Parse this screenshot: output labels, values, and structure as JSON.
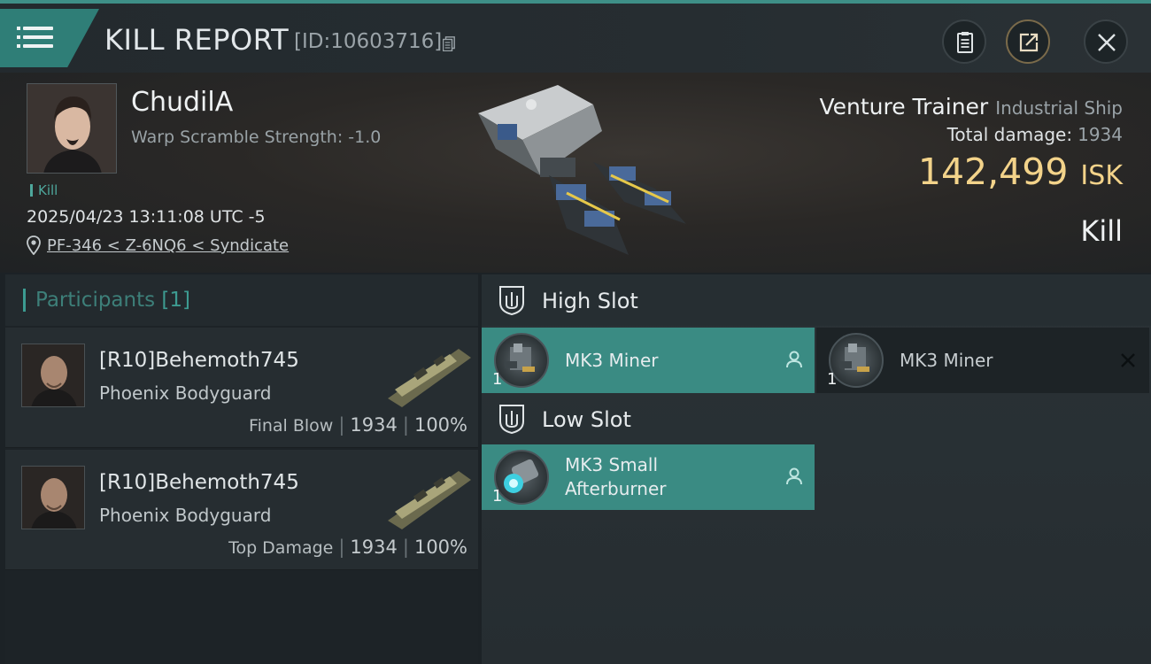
{
  "header": {
    "menu_icon": "hamburger-menu-icon",
    "title": "KILL REPORT",
    "report_id": "[ID:10603716]",
    "copy_icon": "copy-icon",
    "buttons": [
      "clipboard-icon",
      "share-icon",
      "close-icon"
    ]
  },
  "victim": {
    "name": "ChudilA",
    "warp_scramble": "Warp Scramble Strength: -1.0",
    "tag": "Kill",
    "timestamp": "2025/04/23 13:11:08 UTC -5",
    "location": "PF-346 < Z-6NQ6 < Syndicate",
    "ship_name": "Venture Trainer",
    "ship_class": "Industrial Ship",
    "total_damage_label": "Total damage:",
    "total_damage": "1934",
    "isk_value": "142,499",
    "isk_unit": "ISK",
    "result": "Kill"
  },
  "participants": {
    "label": "Participants",
    "count": "[1]",
    "rows": [
      {
        "name": "[R10]Behemoth745",
        "corp": "Phoenix Bodyguard",
        "role": "Final Blow",
        "damage": "1934",
        "percent": "100%",
        "sep": "|"
      },
      {
        "name": "[R10]Behemoth745",
        "corp": "Phoenix Bodyguard",
        "role": "Top Damage",
        "damage": "1934",
        "percent": "100%",
        "sep": "|"
      }
    ]
  },
  "slots": {
    "high": {
      "label": "High Slot",
      "modules": [
        {
          "name": "MK3 Miner",
          "qty": "1",
          "state": "active"
        },
        {
          "name": "MK3 Miner",
          "qty": "1",
          "state": "destroyed"
        }
      ]
    },
    "low": {
      "label": "Low Slot",
      "modules": [
        {
          "name": "MK3 Small Afterburner",
          "qty": "1",
          "state": "active"
        }
      ]
    }
  },
  "colors": {
    "accent": "#3a8b83",
    "isk": "#f3d38a",
    "kill_tag": "#4ea79c"
  }
}
